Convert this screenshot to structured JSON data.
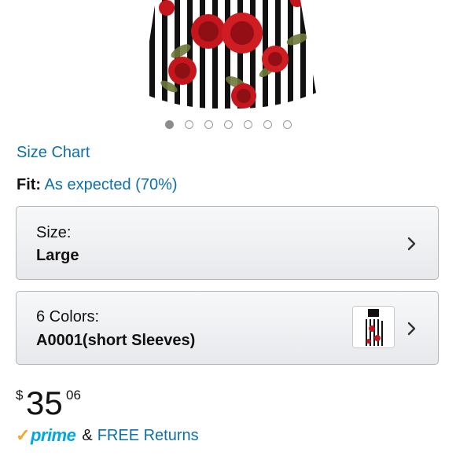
{
  "carousel": {
    "dot_count": 7,
    "active_index": 0
  },
  "size_chart": {
    "label": "Size Chart"
  },
  "fit": {
    "label": "Fit:",
    "value": "As expected (70%)"
  },
  "size_selector": {
    "label": "Size:",
    "value": "Large"
  },
  "color_selector": {
    "label": "6 Colors:",
    "value": "A0001(short Sleeves)"
  },
  "price": {
    "currency": "$",
    "whole": "35",
    "fraction": "06"
  },
  "shipping": {
    "prime_text": "prime",
    "ampersand": "&",
    "returns_text": "FREE Returns"
  },
  "colors": {
    "link": "#0f6fa8",
    "prime_blue": "#00a8e1",
    "prime_check": "#f7a62c"
  }
}
